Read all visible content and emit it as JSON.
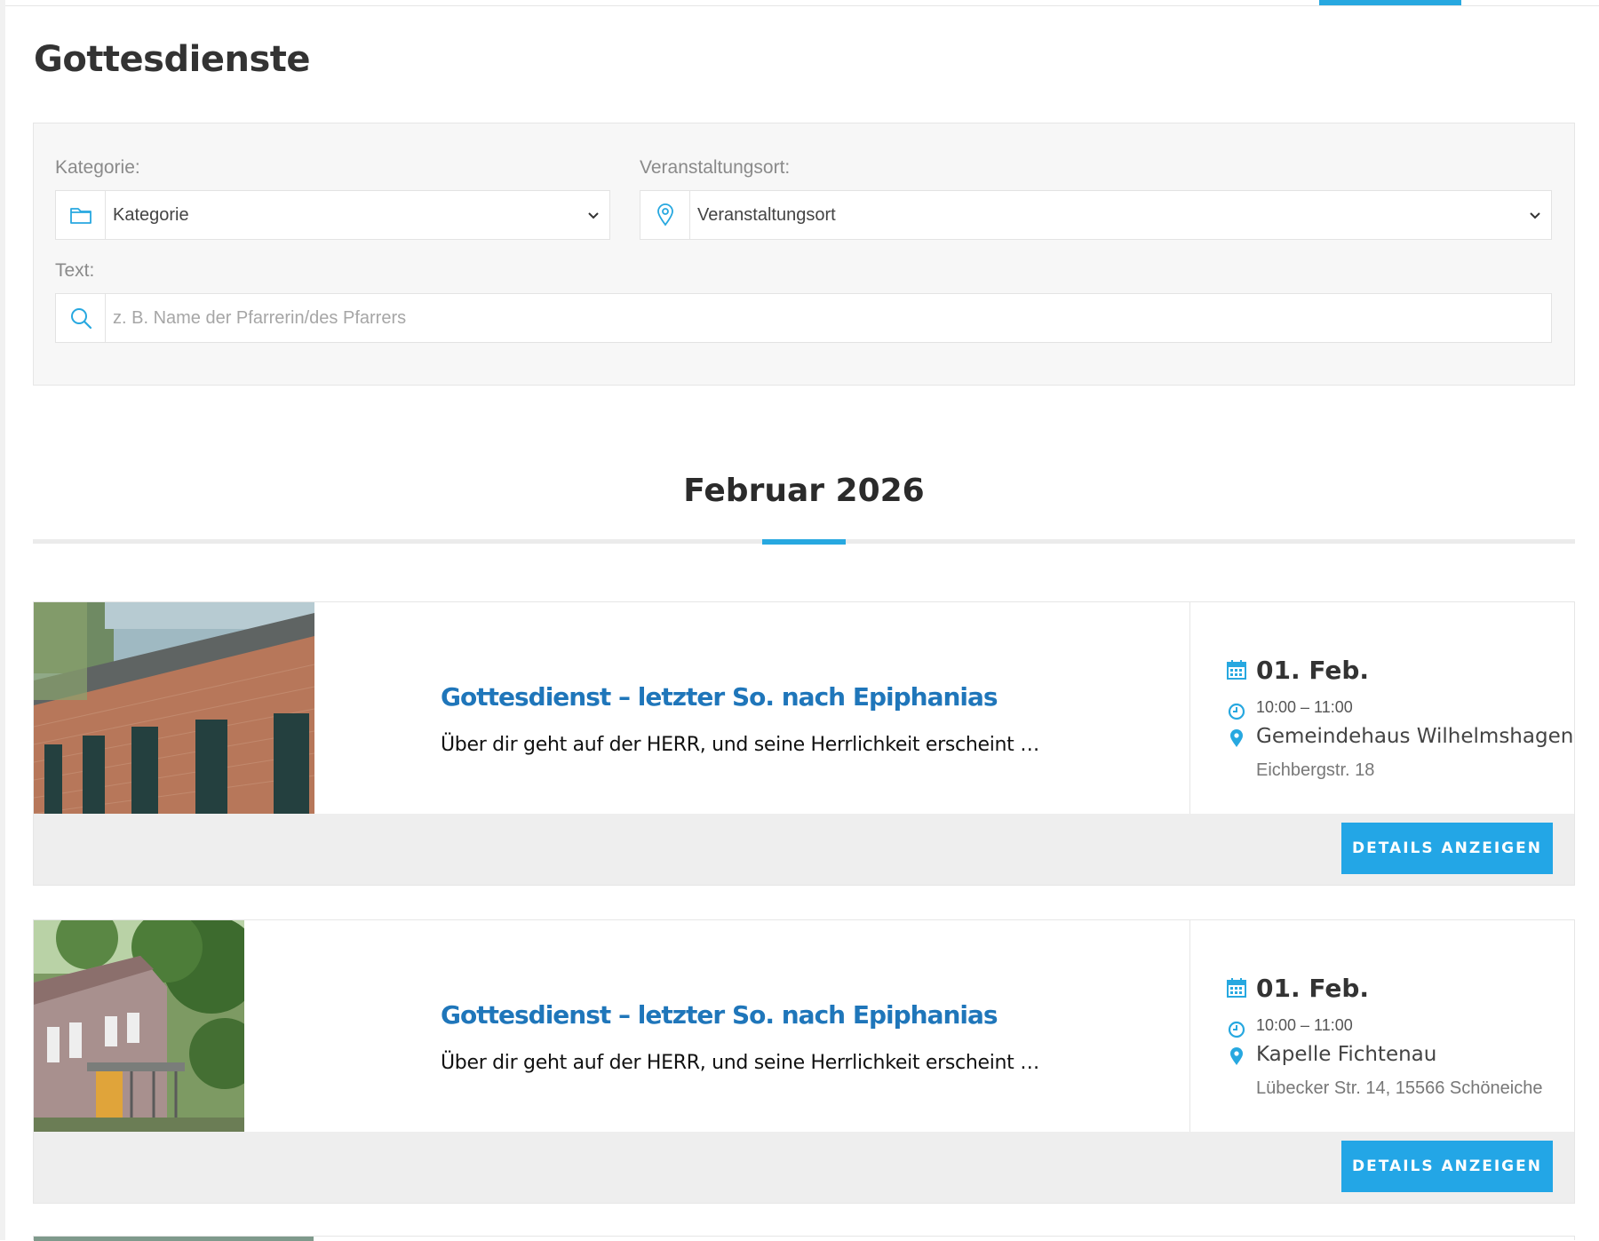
{
  "page": {
    "title": "Gottesdienste"
  },
  "filters": {
    "category": {
      "label": "Kategorie:",
      "value": "Kategorie",
      "icon": "folder-icon"
    },
    "location": {
      "label": "Veranstaltungsort:",
      "value": "Veranstaltungsort",
      "icon": "location-pin-icon"
    },
    "text": {
      "label": "Text:",
      "placeholder": "z. B. Name der Pfarrerin/des Pfarrers",
      "icon": "search-icon"
    }
  },
  "month": {
    "title": "Februar 2026"
  },
  "events": [
    {
      "title": "Gottesdienst – letzter So. nach Epiphanias",
      "excerpt": "Über dir geht auf der HERR, und seine Herrlichkeit erscheint …",
      "date": "01. Feb.",
      "time": "10:00 – 11:00",
      "place": "Gemeindehaus Wilhelmshagen",
      "address": "Eichbergstr. 18",
      "button": "DETAILS ANZEIGEN"
    },
    {
      "title": "Gottesdienst – letzter So. nach Epiphanias",
      "excerpt": "Über dir geht auf der HERR, und seine Herrlichkeit erscheint …",
      "date": "01. Feb.",
      "time": "10:00 – 11:00",
      "place": "Kapelle Fichtenau",
      "address": "Lübecker Str. 14, 15566 Schöneiche",
      "button": "DETAILS ANZEIGEN"
    }
  ],
  "colors": {
    "accent": "#27a8e0",
    "link": "#1f76ba",
    "button": "#23a6e6"
  }
}
